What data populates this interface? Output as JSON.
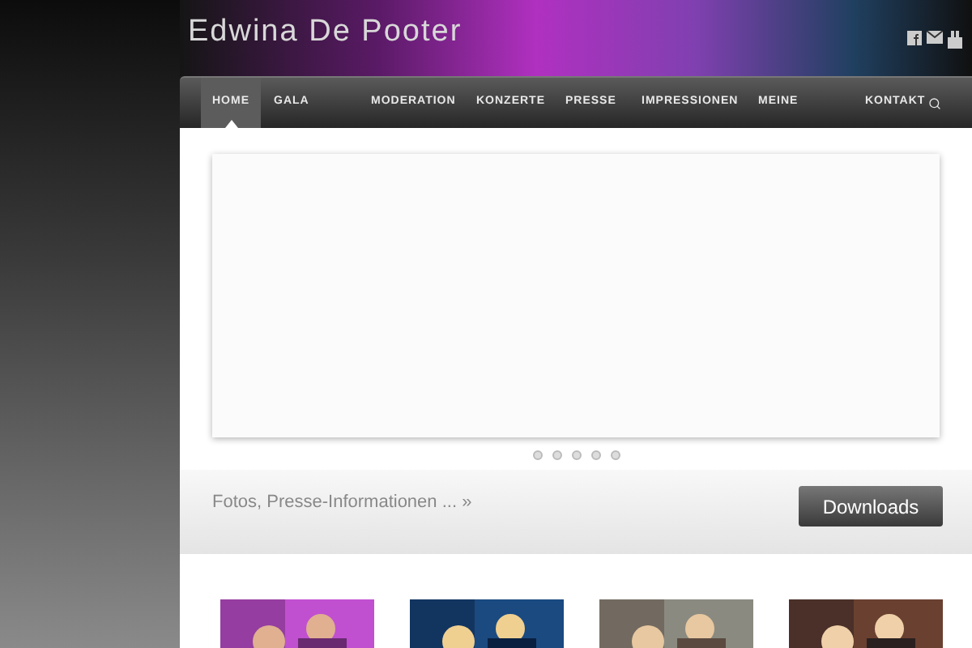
{
  "site_title": "Edwina De Pooter",
  "nav": [
    {
      "label": "HOME",
      "selected": true
    },
    {
      "label": "GALA",
      "selected": false
    },
    {
      "label": "MODERATION",
      "selected": false
    },
    {
      "label": "KONZERTE",
      "selected": false
    },
    {
      "label": "PRESSE",
      "selected": false
    },
    {
      "label": "IMPRESSIONEN",
      "selected": false
    },
    {
      "label": "MEINE",
      "selected": false
    },
    {
      "label": "KONTAKT",
      "selected": false
    }
  ],
  "slider": {
    "dots": [
      {
        "kind": "dot"
      },
      {
        "kind": "dot"
      },
      {
        "kind": "dot"
      },
      {
        "kind": "dot"
      },
      {
        "kind": "dot"
      }
    ]
  },
  "teaser": {
    "text": "Fotos, Presse-Informationen ... »",
    "button": "Downloads"
  }
}
